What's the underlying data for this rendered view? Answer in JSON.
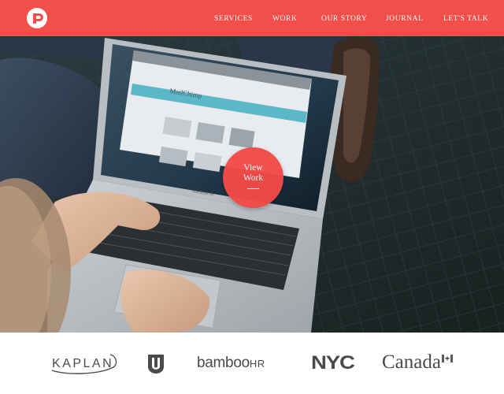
{
  "header": {
    "logo_icon": "brand-logo-icon",
    "nav": [
      "SERVICES",
      "WORK",
      "OUR STORY",
      "JOURNAL",
      "LET'S TALK"
    ]
  },
  "hero": {
    "cta_line1": "View",
    "cta_line2": "Work",
    "laptop_screen_brand": "MailChimp",
    "laptop_label": "MacBook Air"
  },
  "clients": {
    "kaplan": "KAPLAN",
    "bamboo_main": "bamboo",
    "bamboo_suffix": "HR",
    "nyc": "NYC",
    "canada": "Canada"
  },
  "colors": {
    "brand_red": "#f24e4a",
    "client_logo_gray": "#4a4a4a"
  }
}
